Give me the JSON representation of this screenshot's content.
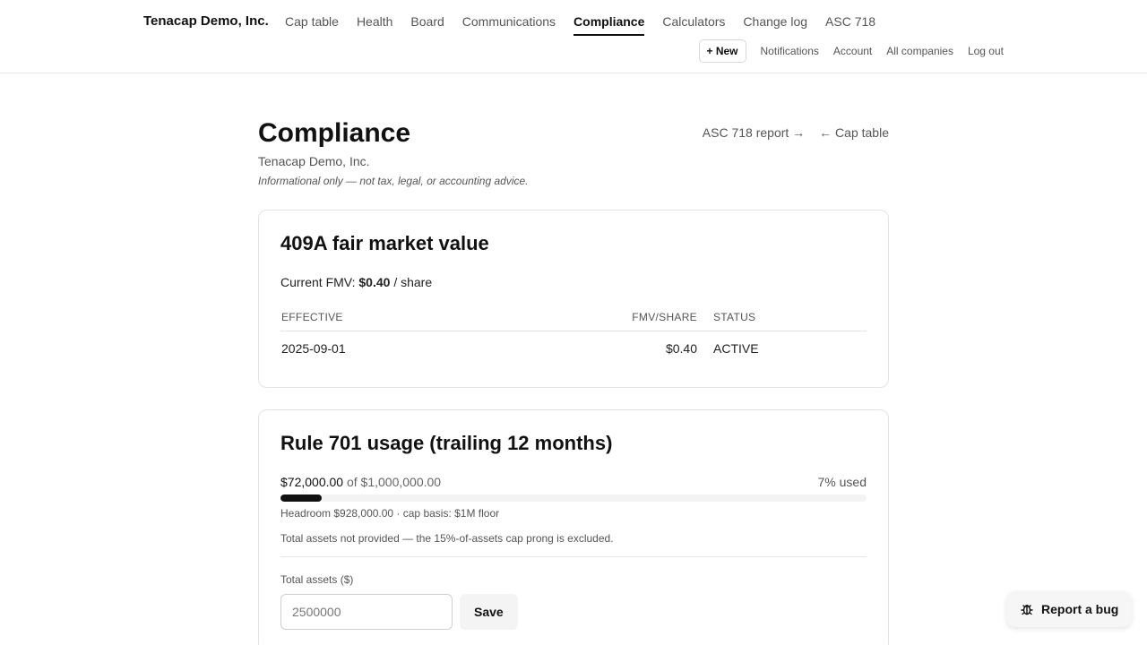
{
  "header": {
    "company": "Tenacap Demo, Inc.",
    "nav": [
      {
        "label": "Cap table",
        "active": false
      },
      {
        "label": "Health",
        "active": false
      },
      {
        "label": "Board",
        "active": false
      },
      {
        "label": "Communications",
        "active": false
      },
      {
        "label": "Compliance",
        "active": true
      },
      {
        "label": "Calculators",
        "active": false
      },
      {
        "label": "Change log",
        "active": false
      },
      {
        "label": "ASC 718",
        "active": false
      }
    ],
    "new_label": "+ New",
    "subnav": [
      "Notifications",
      "Account",
      "All companies",
      "Log out"
    ]
  },
  "page": {
    "title": "Compliance",
    "subtitle": "Tenacap Demo, Inc.",
    "disclaimer": "Informational only — not tax, legal, or accounting advice.",
    "asc_link": "ASC 718 report →",
    "cap_link": "← Cap table"
  },
  "fmv": {
    "title": "409A fair market value",
    "current_prefix": "Current FMV: ",
    "current_value": "$0.40",
    "current_suffix": " / share",
    "columns": [
      "EFFECTIVE",
      "FMV/SHARE",
      "STATUS"
    ],
    "rows": [
      {
        "effective": "2025-09-01",
        "fmv": "$0.40",
        "status": "ACTIVE"
      }
    ]
  },
  "rule701": {
    "title": "Rule 701 usage (trailing 12 months)",
    "used": "$72,000.00",
    "of_text": " of $1,000,000.00",
    "pct_text": "7% used",
    "pct_value": 7,
    "headroom": "Headroom $928,000.00 · cap basis: $1M floor",
    "note": "Total assets not provided — the 15%-of-assets cap prong is excluded.",
    "assets_label": "Total assets ($)",
    "assets_placeholder": "2500000",
    "save_label": "Save"
  },
  "bug": {
    "label": "Report a bug",
    "icon": "bug-icon"
  }
}
